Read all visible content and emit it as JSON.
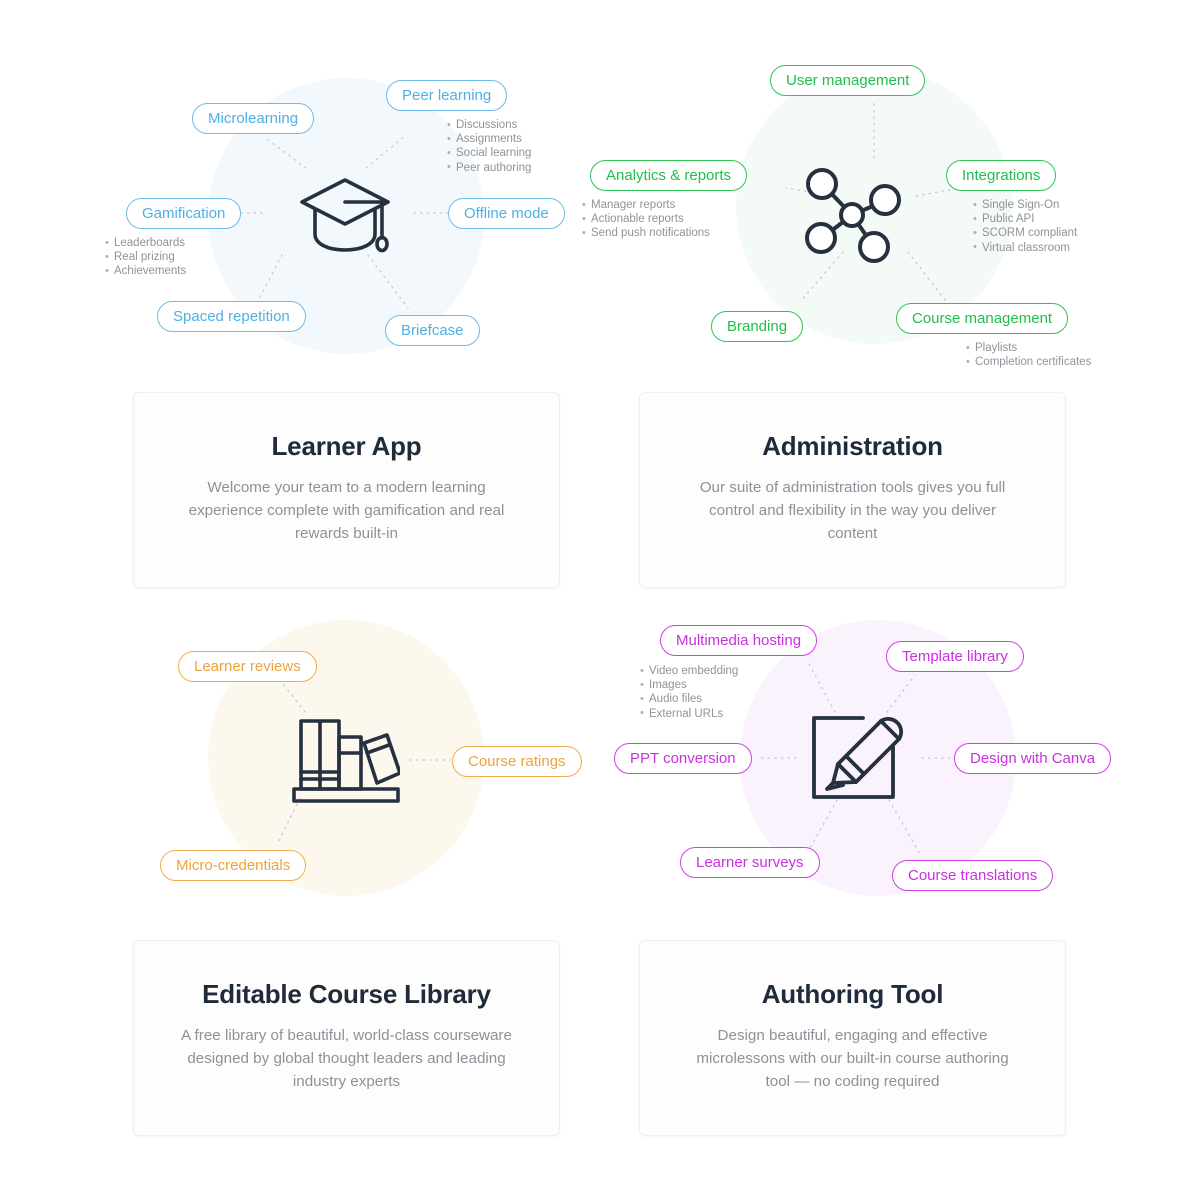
{
  "palette": {
    "blue": "#4fb0e4",
    "green": "#22bd4c",
    "orange": "#eda33b",
    "purple": "#ca2fe0",
    "icon_dark": "#26303f",
    "body_text": "#8b9299",
    "heading": "#1f2a3a"
  },
  "sections": [
    {
      "key": "learner_app",
      "accent": "blue",
      "center_icon": "graduation-cap-icon",
      "card": {
        "title": "Learner App",
        "description": "Welcome your team to a modern learning experience complete with gamification and real rewards built-in"
      },
      "pills": [
        {
          "label": "Peer learning"
        },
        {
          "label": "Microlearning"
        },
        {
          "label": "Gamification"
        },
        {
          "label": "Offline mode"
        },
        {
          "label": "Spaced repetition"
        },
        {
          "label": "Briefcase"
        }
      ],
      "bullet_groups": [
        {
          "owner": "Peer learning",
          "items": [
            "Discussions",
            "Assignments",
            "Social learning",
            "Peer authoring"
          ]
        },
        {
          "owner": "Gamification",
          "items": [
            "Leaderboards",
            "Real prizing",
            "Achievements"
          ]
        }
      ]
    },
    {
      "key": "administration",
      "accent": "green",
      "center_icon": "network-nodes-icon",
      "card": {
        "title": "Administration",
        "description": "Our suite of administration tools gives you full control and flexibility in the way you deliver content"
      },
      "pills": [
        {
          "label": "User management"
        },
        {
          "label": "Analytics & reports"
        },
        {
          "label": "Integrations"
        },
        {
          "label": "Branding"
        },
        {
          "label": "Course management"
        }
      ],
      "bullet_groups": [
        {
          "owner": "Analytics & reports",
          "items": [
            "Manager reports",
            "Actionable reports",
            "Send push notifications"
          ]
        },
        {
          "owner": "Integrations",
          "items": [
            "Single Sign-On",
            "Public API",
            "SCORM compliant",
            "Virtual classroom"
          ]
        },
        {
          "owner": "Course management",
          "items": [
            "Playlists",
            "Completion certificates"
          ]
        }
      ]
    },
    {
      "key": "editable_course_library",
      "accent": "orange",
      "center_icon": "books-shelf-icon",
      "card": {
        "title": "Editable Course Library",
        "description": "A free library of beautiful, world-class courseware designed by global thought leaders and leading industry experts"
      },
      "pills": [
        {
          "label": "Learner reviews"
        },
        {
          "label": "Course ratings"
        },
        {
          "label": "Micro-credentials"
        }
      ],
      "bullet_groups": []
    },
    {
      "key": "authoring_tool",
      "accent": "purple",
      "center_icon": "pencil-square-icon",
      "card": {
        "title": "Authoring Tool",
        "description": "Design beautiful, engaging and effective microlessons with our built-in course authoring tool — no coding required"
      },
      "pills": [
        {
          "label": "Multimedia hosting"
        },
        {
          "label": "Template library"
        },
        {
          "label": "PPT conversion"
        },
        {
          "label": "Design with Canva"
        },
        {
          "label": "Learner surveys"
        },
        {
          "label": "Course translations"
        }
      ],
      "bullet_groups": [
        {
          "owner": "Multimedia hosting",
          "items": [
            "Video embedding",
            "Images",
            "Audio files",
            "External URLs"
          ]
        }
      ]
    }
  ]
}
